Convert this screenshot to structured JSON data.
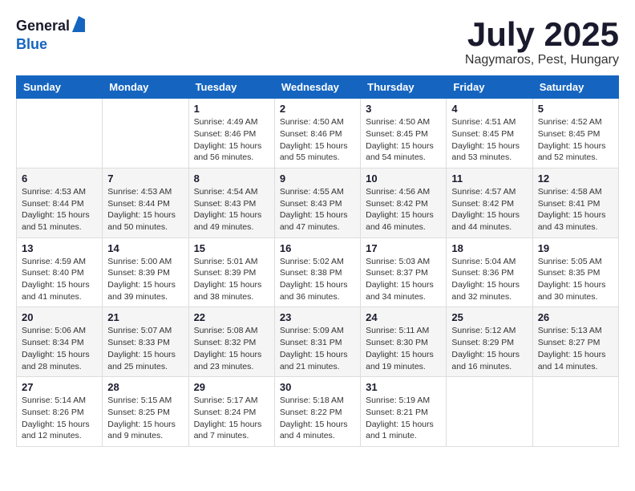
{
  "logo": {
    "general": "General",
    "blue": "Blue"
  },
  "title": {
    "month_year": "July 2025",
    "location": "Nagymaros, Pest, Hungary"
  },
  "days_of_week": [
    "Sunday",
    "Monday",
    "Tuesday",
    "Wednesday",
    "Thursday",
    "Friday",
    "Saturday"
  ],
  "weeks": [
    [
      null,
      null,
      {
        "day": 1,
        "sunrise": "4:49 AM",
        "sunset": "8:46 PM",
        "daylight": "15 hours and 56 minutes."
      },
      {
        "day": 2,
        "sunrise": "4:50 AM",
        "sunset": "8:46 PM",
        "daylight": "15 hours and 55 minutes."
      },
      {
        "day": 3,
        "sunrise": "4:50 AM",
        "sunset": "8:45 PM",
        "daylight": "15 hours and 54 minutes."
      },
      {
        "day": 4,
        "sunrise": "4:51 AM",
        "sunset": "8:45 PM",
        "daylight": "15 hours and 53 minutes."
      },
      {
        "day": 5,
        "sunrise": "4:52 AM",
        "sunset": "8:45 PM",
        "daylight": "15 hours and 52 minutes."
      }
    ],
    [
      {
        "day": 6,
        "sunrise": "4:53 AM",
        "sunset": "8:44 PM",
        "daylight": "15 hours and 51 minutes."
      },
      {
        "day": 7,
        "sunrise": "4:53 AM",
        "sunset": "8:44 PM",
        "daylight": "15 hours and 50 minutes."
      },
      {
        "day": 8,
        "sunrise": "4:54 AM",
        "sunset": "8:43 PM",
        "daylight": "15 hours and 49 minutes."
      },
      {
        "day": 9,
        "sunrise": "4:55 AM",
        "sunset": "8:43 PM",
        "daylight": "15 hours and 47 minutes."
      },
      {
        "day": 10,
        "sunrise": "4:56 AM",
        "sunset": "8:42 PM",
        "daylight": "15 hours and 46 minutes."
      },
      {
        "day": 11,
        "sunrise": "4:57 AM",
        "sunset": "8:42 PM",
        "daylight": "15 hours and 44 minutes."
      },
      {
        "day": 12,
        "sunrise": "4:58 AM",
        "sunset": "8:41 PM",
        "daylight": "15 hours and 43 minutes."
      }
    ],
    [
      {
        "day": 13,
        "sunrise": "4:59 AM",
        "sunset": "8:40 PM",
        "daylight": "15 hours and 41 minutes."
      },
      {
        "day": 14,
        "sunrise": "5:00 AM",
        "sunset": "8:39 PM",
        "daylight": "15 hours and 39 minutes."
      },
      {
        "day": 15,
        "sunrise": "5:01 AM",
        "sunset": "8:39 PM",
        "daylight": "15 hours and 38 minutes."
      },
      {
        "day": 16,
        "sunrise": "5:02 AM",
        "sunset": "8:38 PM",
        "daylight": "15 hours and 36 minutes."
      },
      {
        "day": 17,
        "sunrise": "5:03 AM",
        "sunset": "8:37 PM",
        "daylight": "15 hours and 34 minutes."
      },
      {
        "day": 18,
        "sunrise": "5:04 AM",
        "sunset": "8:36 PM",
        "daylight": "15 hours and 32 minutes."
      },
      {
        "day": 19,
        "sunrise": "5:05 AM",
        "sunset": "8:35 PM",
        "daylight": "15 hours and 30 minutes."
      }
    ],
    [
      {
        "day": 20,
        "sunrise": "5:06 AM",
        "sunset": "8:34 PM",
        "daylight": "15 hours and 28 minutes."
      },
      {
        "day": 21,
        "sunrise": "5:07 AM",
        "sunset": "8:33 PM",
        "daylight": "15 hours and 25 minutes."
      },
      {
        "day": 22,
        "sunrise": "5:08 AM",
        "sunset": "8:32 PM",
        "daylight": "15 hours and 23 minutes."
      },
      {
        "day": 23,
        "sunrise": "5:09 AM",
        "sunset": "8:31 PM",
        "daylight": "15 hours and 21 minutes."
      },
      {
        "day": 24,
        "sunrise": "5:11 AM",
        "sunset": "8:30 PM",
        "daylight": "15 hours and 19 minutes."
      },
      {
        "day": 25,
        "sunrise": "5:12 AM",
        "sunset": "8:29 PM",
        "daylight": "15 hours and 16 minutes."
      },
      {
        "day": 26,
        "sunrise": "5:13 AM",
        "sunset": "8:27 PM",
        "daylight": "15 hours and 14 minutes."
      }
    ],
    [
      {
        "day": 27,
        "sunrise": "5:14 AM",
        "sunset": "8:26 PM",
        "daylight": "15 hours and 12 minutes."
      },
      {
        "day": 28,
        "sunrise": "5:15 AM",
        "sunset": "8:25 PM",
        "daylight": "15 hours and 9 minutes."
      },
      {
        "day": 29,
        "sunrise": "5:17 AM",
        "sunset": "8:24 PM",
        "daylight": "15 hours and 7 minutes."
      },
      {
        "day": 30,
        "sunrise": "5:18 AM",
        "sunset": "8:22 PM",
        "daylight": "15 hours and 4 minutes."
      },
      {
        "day": 31,
        "sunrise": "5:19 AM",
        "sunset": "8:21 PM",
        "daylight": "15 hours and 1 minute."
      },
      null,
      null
    ]
  ]
}
